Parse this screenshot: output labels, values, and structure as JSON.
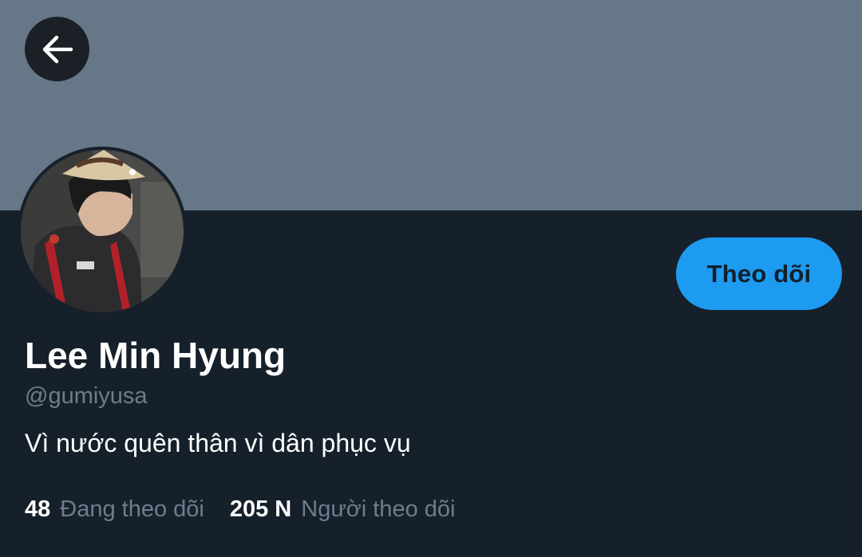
{
  "profile": {
    "display_name": "Lee Min Hyung",
    "handle": "@gumiyusa",
    "bio": "Vì nước quên thân vì dân phục vụ",
    "follow_label": "Theo dõi",
    "avatar_icon": "profile-photo"
  },
  "stats": {
    "following_count": "48",
    "following_label": "Đang theo dõi",
    "followers_count": "205 N",
    "followers_label": "Người theo dõi"
  },
  "icons": {
    "back": "arrow-left-icon"
  },
  "colors": {
    "background": "#16202b",
    "banner": "#667788",
    "accent": "#1d9bf0",
    "secondary_text": "#6e7d8c",
    "primary_text": "#ffffff"
  }
}
